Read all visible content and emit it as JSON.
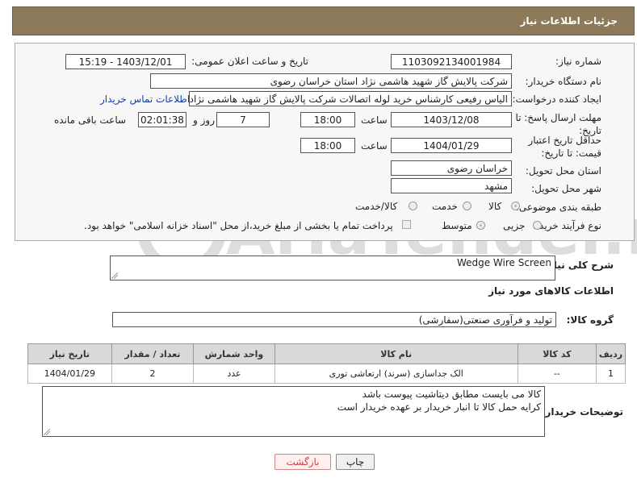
{
  "header": {
    "title": "جزئیات اطلاعات نیاز"
  },
  "fields": {
    "need_number_label": "شماره نیاز:",
    "need_number": "1103092134001984",
    "announce_label": "تاریخ و ساعت اعلان عمومی:",
    "announce_value": "1403/12/01 - 15:19",
    "buyer_org_label": "نام دستگاه خریدار:",
    "buyer_org": "شرکت پالایش گاز شهید هاشمی نژاد   استان خراسان رضوی",
    "creator_label": "ایجاد کننده درخواست:",
    "creator": "الیاس رفیعی کارشناس خرید لوله اتصالات شرکت پالایش گاز شهید هاشمی نژاد",
    "contact_link": "اطلاعات تماس خریدار",
    "reply_deadline_label": "مهلت ارسال پاسخ: تا تاریخ:",
    "reply_date": "1403/12/08",
    "time_label": "ساعت",
    "reply_time": "18:00",
    "days_value": "7",
    "days_label": "روز و",
    "remaining_value": "02:01:38",
    "remaining_label": "ساعت باقی مانده",
    "validity_label": "حداقل تاریخ اعتبار قیمت: تا تاریخ:",
    "validity_date": "1404/01/29",
    "validity_time": "18:00",
    "province_label": "استان محل تحویل:",
    "province": "خراسان رضوی",
    "city_label": "شهر محل تحویل:",
    "city": "مشهد",
    "category_label": "طبقه بندی موضوعی:",
    "category_options": [
      "کالا",
      "خدمت",
      "کالا/خدمت"
    ],
    "process_label": "نوع فرآیند خرید :",
    "process_options": [
      "جزیی",
      "متوسط"
    ],
    "payment_note": "پرداخت تمام یا بخشی از مبلغ خرید،از محل \"اسناد خزانه اسلامی\" خواهد بود."
  },
  "summary": {
    "label": "شرح کلی نیاز:",
    "value": "Wedge Wire Screen"
  },
  "goods_info": {
    "title": "اطلاعات کالاهای مورد نیاز",
    "group_label": "گروه کالا:",
    "group_value": "تولید و فرآوری صنعتی(سفارشی)"
  },
  "table": {
    "headers": [
      "ردیف",
      "کد کالا",
      "نام کالا",
      "واحد شمارش",
      "تعداد / مقدار",
      "تاریخ نیاز"
    ],
    "rows": [
      [
        "1",
        "--",
        "الک جداسازی (سرند) ارتعاشی توری",
        "عدد",
        "2",
        "1404/01/29"
      ]
    ]
  },
  "buyer_notes": {
    "label": "توضیحات خریدار:",
    "line1": "کالا می بایست مطابق دیتاشیت پیوست باشد",
    "line2": "کرایه حمل کالا تا انبار خریدار بر عهده خریدار است"
  },
  "buttons": {
    "print": "چاپ",
    "back": "بازگشت"
  },
  "watermark": {
    "text": "AriaTender.neT"
  }
}
